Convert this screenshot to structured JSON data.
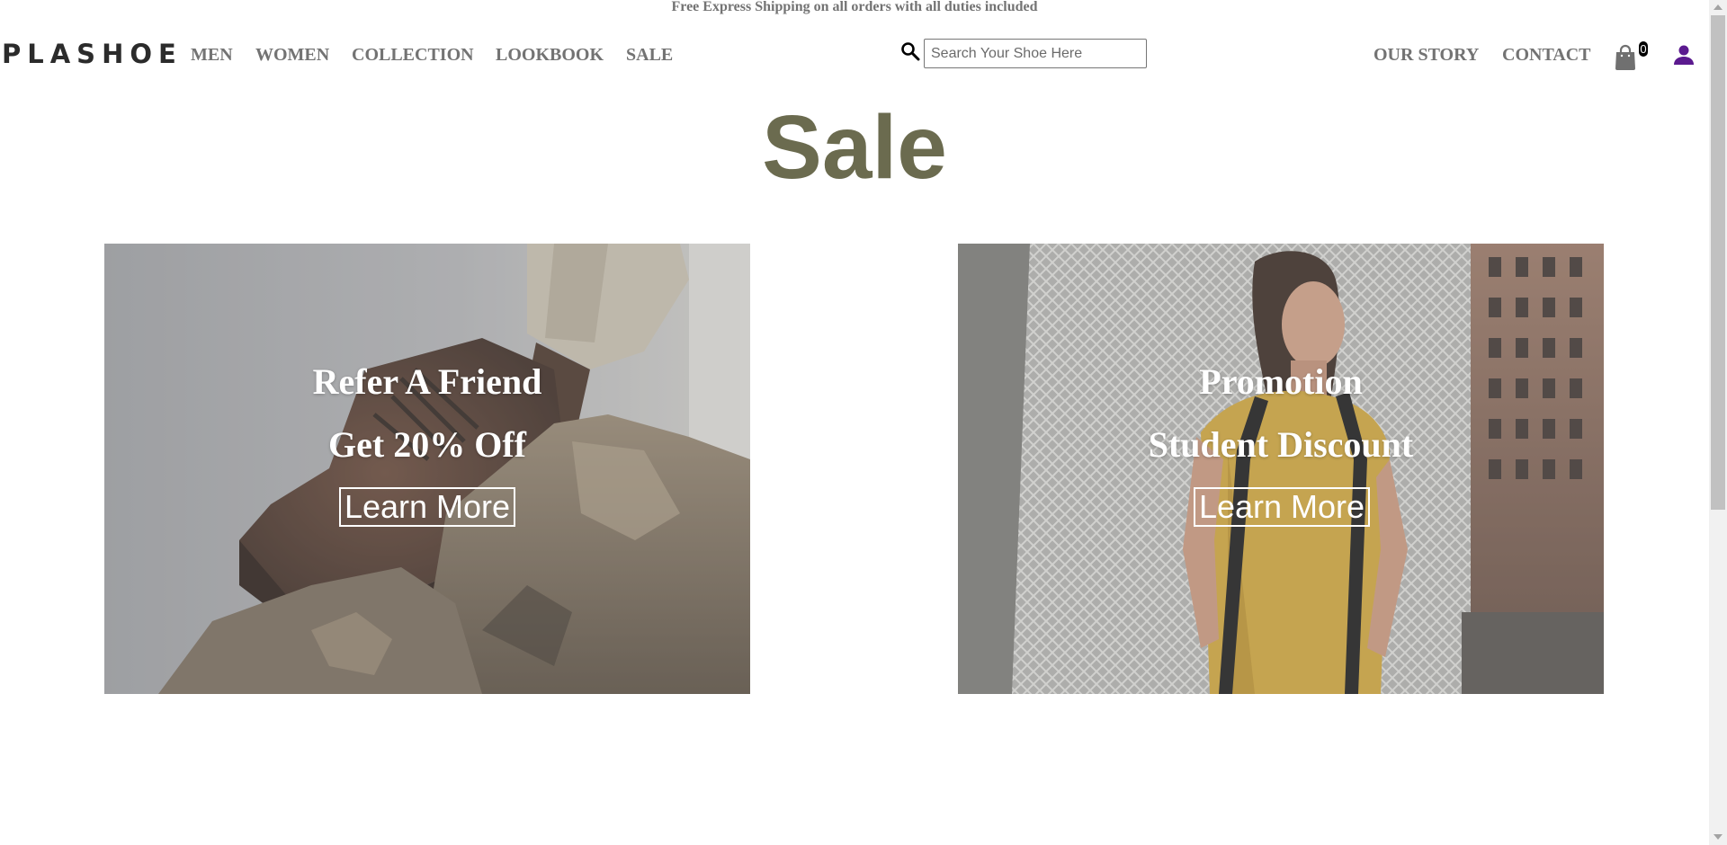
{
  "announcement": "Free Express Shipping on all orders with all duties included",
  "header": {
    "logo": "PLASHOE",
    "nav_left": [
      "MEN",
      "WOMEN",
      "COLLECTION",
      "LOOKBOOK",
      "SALE"
    ],
    "search_placeholder": "Search Your Shoe Here",
    "nav_right": [
      "OUR STORY",
      "CONTACT"
    ],
    "cart_count": "0",
    "icons": {
      "search": "search-icon",
      "cart": "shopping-bag-icon",
      "user": "user-icon"
    },
    "user_icon_color": "#5b1a8f"
  },
  "main": {
    "title": "Sale",
    "title_color": "#6b6b4f",
    "cards": [
      {
        "line1": "Refer A Friend",
        "line2": "Get 20% Off",
        "button": "Learn More",
        "image": "photo of a brown leather boot resting on a rock"
      },
      {
        "line1": "Promotion",
        "line2": "Student Discount",
        "button": "Learn More",
        "image": "photo of a smiling young woman in a yellow t-shirt with a backpack"
      }
    ]
  }
}
